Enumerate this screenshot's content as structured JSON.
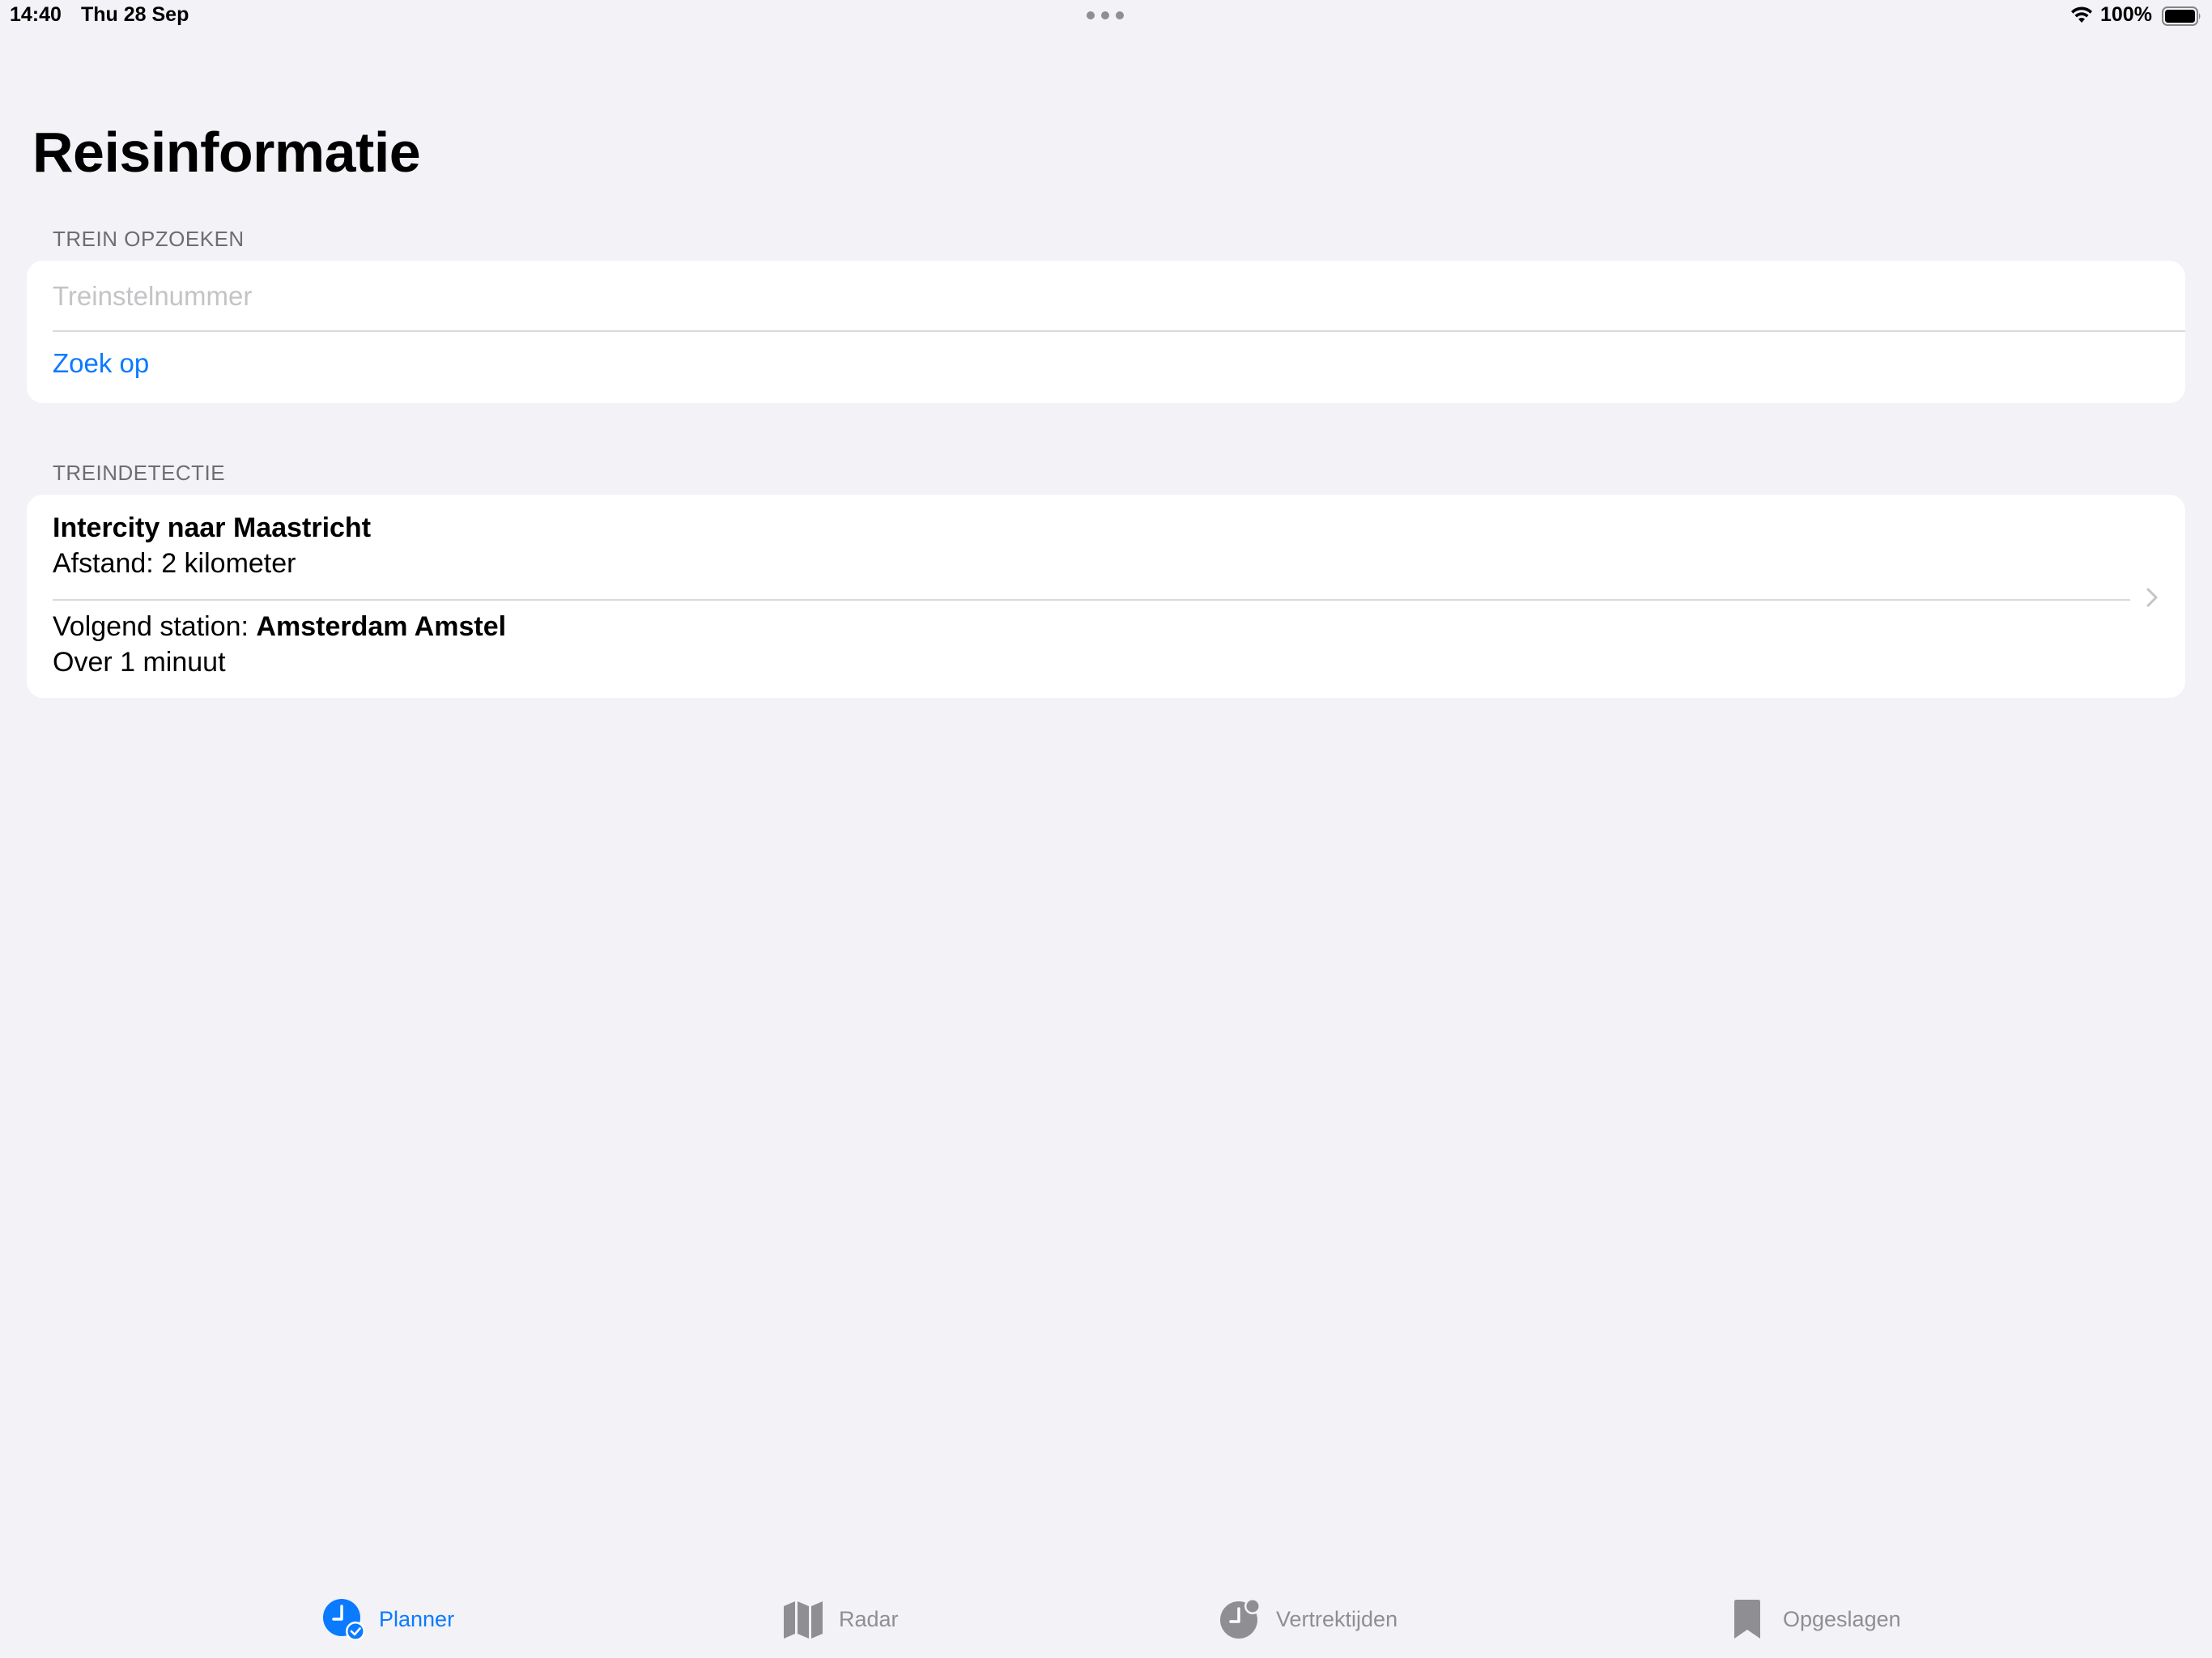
{
  "status_bar": {
    "time": "14:40",
    "date": "Thu 28 Sep",
    "battery": "100%"
  },
  "page": {
    "title": "Reisinformatie"
  },
  "lookup_section": {
    "header": "TREIN OPZOEKEN",
    "input_value": "",
    "input_placeholder": "Treinstelnummer",
    "search_label": "Zoek op"
  },
  "detection_section": {
    "header": "TREINDETECTIE",
    "train_name": "Intercity naar Maastricht",
    "distance": "Afstand: 2 kilometer",
    "next_station_label": "Volgend station:",
    "next_station": "Amsterdam Amstel",
    "eta": "Over 1 minuut"
  },
  "tab_bar": {
    "tabs": [
      {
        "label": "Planner",
        "icon": "clock-check-icon",
        "active": true
      },
      {
        "label": "Radar",
        "icon": "map-icon",
        "active": false
      },
      {
        "label": "Vertrektijden",
        "icon": "clock-badge-icon",
        "active": false
      },
      {
        "label": "Opgeslagen",
        "icon": "bookmark-icon",
        "active": false
      }
    ]
  },
  "colors": {
    "accent": "#0a7aff",
    "background": "#f2f2f7",
    "secondary_text": "#6d6d72",
    "tab_inactive": "#8e8e93"
  }
}
